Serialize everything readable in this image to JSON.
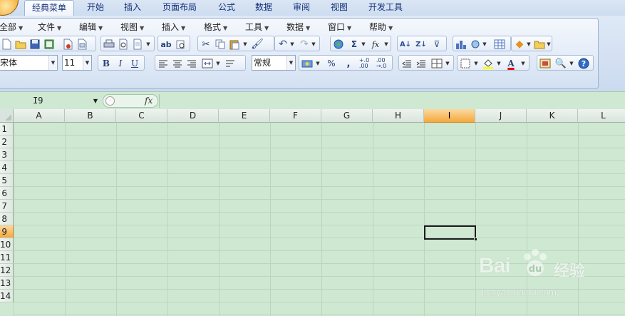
{
  "ribbon": {
    "tabs": [
      "经典菜单",
      "开始",
      "插入",
      "页面布局",
      "公式",
      "数据",
      "审阅",
      "视图",
      "开发工具"
    ],
    "active_tab": "经典菜单"
  },
  "menubar": {
    "items": [
      "全部",
      "文件",
      "编辑",
      "视图",
      "插入",
      "格式",
      "工具",
      "数据",
      "窗口",
      "帮助"
    ]
  },
  "formatting": {
    "font_name": "宋体",
    "font_size": "11",
    "bold": "B",
    "italic": "I",
    "underline": "U",
    "number_format": "常规",
    "percent": "%",
    "comma": ",",
    "sum": "Σ",
    "function": "fx"
  },
  "formula_bar": {
    "name_box": "I9",
    "fx_label": "fx",
    "formula": ""
  },
  "sheet": {
    "columns": [
      "A",
      "B",
      "C",
      "D",
      "E",
      "F",
      "G",
      "H",
      "I",
      "J",
      "K",
      "L"
    ],
    "rows": [
      "1",
      "2",
      "3",
      "4",
      "5",
      "6",
      "7",
      "8",
      "9",
      "10",
      "11",
      "12",
      "13",
      "14"
    ],
    "selected_column": "I",
    "selected_row": "9",
    "active_cell": "I9"
  },
  "watermark": {
    "brand": "Bai",
    "brand_suffix": "经验",
    "url": "jingyan.baidu.com"
  },
  "colors": {
    "sheet_bg": "#cfe8d2",
    "header_selected": "#f4a93e",
    "ribbon_bg": "#dfe9f6"
  }
}
